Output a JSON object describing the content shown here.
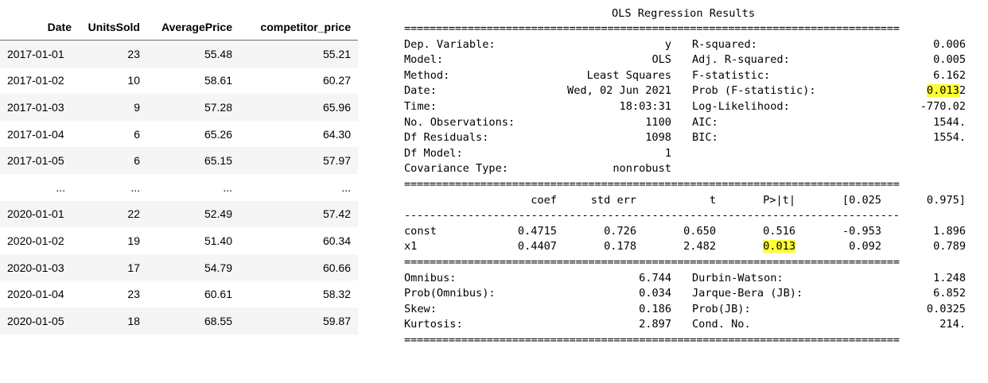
{
  "dataframe": {
    "columns": [
      "Date",
      "UnitsSold",
      "AveragePrice",
      "competitor_price"
    ],
    "rows": [
      [
        "2017-01-01",
        "23",
        "55.48",
        "55.21"
      ],
      [
        "2017-01-02",
        "10",
        "58.61",
        "60.27"
      ],
      [
        "2017-01-03",
        "9",
        "57.28",
        "65.96"
      ],
      [
        "2017-01-04",
        "6",
        "65.26",
        "64.30"
      ],
      [
        "2017-01-05",
        "6",
        "65.15",
        "57.97"
      ],
      [
        "...",
        "...",
        "...",
        "..."
      ],
      [
        "2020-01-01",
        "22",
        "52.49",
        "57.42"
      ],
      [
        "2020-01-02",
        "19",
        "51.40",
        "60.34"
      ],
      [
        "2020-01-03",
        "17",
        "54.79",
        "60.66"
      ],
      [
        "2020-01-04",
        "23",
        "60.61",
        "58.32"
      ],
      [
        "2020-01-05",
        "18",
        "68.55",
        "59.87"
      ]
    ]
  },
  "ols": {
    "title": "OLS Regression Results",
    "rule_double": "==============================================================================",
    "rule_single": "------------------------------------------------------------------------------",
    "summary": [
      [
        "Dep. Variable:",
        "y",
        "R-squared:",
        "0.006"
      ],
      [
        "Model:",
        "OLS",
        "Adj. R-squared:",
        "0.005"
      ],
      [
        "Method:",
        "Least Squares",
        "F-statistic:",
        "6.162"
      ],
      [
        "Date:",
        "Wed, 02 Jun 2021",
        "Prob (F-statistic):",
        "0.0132"
      ],
      [
        "Time:",
        "18:03:31",
        "Log-Likelihood:",
        "-770.02"
      ],
      [
        "No. Observations:",
        "1100",
        "AIC:",
        "1544."
      ],
      [
        "Df Residuals:",
        "1098",
        "BIC:",
        "1554."
      ],
      [
        "Df Model:",
        "1",
        "",
        ""
      ],
      [
        "Covariance Type:",
        "nonrobust",
        "",
        ""
      ]
    ],
    "params_header": [
      "",
      "coef",
      "std err",
      "t",
      "P>|t|",
      "[0.025",
      "0.975]"
    ],
    "params": [
      [
        "const",
        "0.4715",
        "0.726",
        "0.650",
        "0.516",
        "-0.953",
        "1.896"
      ],
      [
        "x1",
        "0.4407",
        "0.178",
        "2.482",
        "0.013",
        "0.092",
        "0.789"
      ]
    ],
    "diagnostics": [
      [
        "Omnibus:",
        "6.744",
        "Durbin-Watson:",
        "1.248"
      ],
      [
        "Prob(Omnibus):",
        "0.034",
        "Jarque-Bera (JB):",
        "6.852"
      ],
      [
        "Skew:",
        "0.186",
        "Prob(JB):",
        "0.0325"
      ],
      [
        "Kurtosis:",
        "2.897",
        "Cond. No.",
        "214."
      ]
    ],
    "highlight_color": "#ffff33"
  }
}
